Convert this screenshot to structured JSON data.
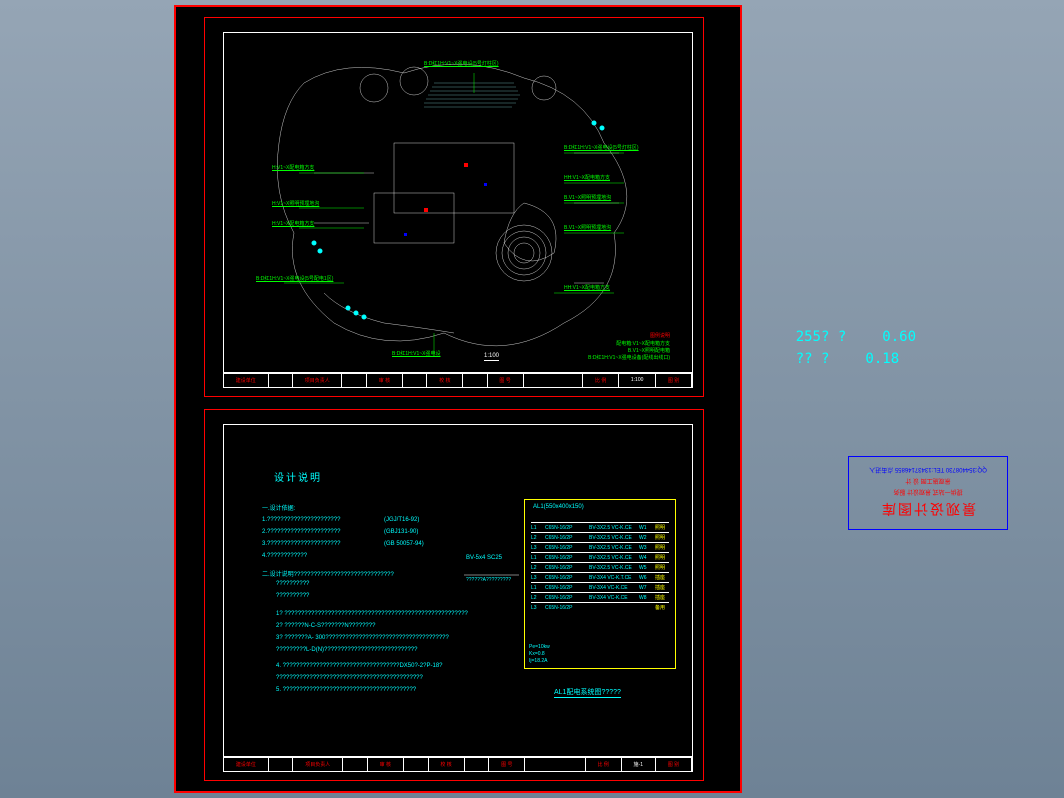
{
  "readout": {
    "r1k": "255?  ?",
    "r1v": "0.60",
    "r2k": "??  ?",
    "r2v": "0.18"
  },
  "stamp": {
    "main": "景观设计图库",
    "l1": "提供一站式 景观设计 服务",
    "l2": "景观施工图 设 计",
    "num": "QQ:354408730  TEL:13437146855  点击进入"
  },
  "plan": {
    "scale": "1:100",
    "legend_title": "图例说明",
    "legend1": "配电箱:V1~X配电箱方支",
    "legend2": "B.V1~X照明配电箱",
    "legend3": "B:D红1H:V1~X强电设备(配线出线口)",
    "labels": {
      "a": "B:D红1H:V1~X强电设(5号灯柱区)",
      "b": "H:V1~X配电箱方支",
      "c": "H:V1~X照明预埋地沟",
      "d": "B:D红1H:V1~X强电设(5号灯柱区)",
      "e": "HH:V1~X配电箱方支",
      "f": "B.V1~X照明预埋地沟",
      "g": "B:D红1H:V1~X强电设(5号配电1区)",
      "h": "H:V1~X配电箱方支",
      "i": "B:D红1H:V1~X强电设",
      "j": "B.V1~X照明预埋地沟"
    }
  },
  "notes": {
    "title": "设计说明",
    "h1": "一.设计依据:",
    "n1": "1.??????????????????????",
    "n1b": "(JGJ/T16-92)",
    "n2": "2.??????????????????????",
    "n2b": "(GBJ131-90)",
    "n3": "3.??????????????????????",
    "n3b": "(GB 50057-94)",
    "n4": "4.????????????",
    "h2": "二.设计说明??????????????????????????????",
    "n5": "??????????",
    "n6": "??????????",
    "n7": "1? ???????????????????????????????????????????????????????",
    "n8": "2? ??????N-C-S???????N????????",
    "n9": "3? ???????A- 300?????????????????????????????????????",
    "n10": "    ?????????L-D(N)????????????????????????????",
    "n11": "4.  ???????????????????????????????????DX50?-2?P-18?",
    "n12": "     ????????????????????????????????????????????",
    "n13": "5.  ????????????????????????????????????????",
    "cable": "BV-5x4  SC25",
    "cable2": "??????A?????????",
    "box_title": "AL1(550x400x150)",
    "panel_title": "AL1配电系统图?????",
    "rows": [
      {
        "l": "L1",
        "m": "C65N-16/2P",
        "r": "BV-3X2.5 VC-K.CE",
        "n": "W1",
        "e": "照明"
      },
      {
        "l": "L2",
        "m": "C65N-16/2P",
        "r": "BV-3X2.5 VC-K.CE",
        "n": "W2",
        "e": "照明"
      },
      {
        "l": "L3",
        "m": "C65N-16/2P",
        "r": "BV-3X2.5 VC-K.CE",
        "n": "W3",
        "e": "照明"
      },
      {
        "l": "L1",
        "m": "C65N-16/2P",
        "r": "BV-3X2.5 VC-K.CE",
        "n": "W4",
        "e": "照明"
      },
      {
        "l": "L2",
        "m": "C65N-16/2P",
        "r": "BV-3X2.5 VC-K.CE",
        "n": "W5",
        "e": "照明"
      },
      {
        "l": "L3",
        "m": "C65N-16/2P",
        "r": "BV-3X4 VC-K.T.CE",
        "n": "W6",
        "e": "插座"
      },
      {
        "l": "L1",
        "m": "C65N-16/2P",
        "r": "BV-3X4 VC-K.CE",
        "n": "W7",
        "e": "插座"
      },
      {
        "l": "L2",
        "m": "C65N-16/2P",
        "r": "BV-3X4 VC-K.CE",
        "n": "W8",
        "e": "插座"
      },
      {
        "l": "L3",
        "m": "C65N-16/2P",
        "r": "",
        "n": "",
        "e": "备用"
      }
    ],
    "box_side1": "Pe=10kw",
    "box_side2": "Kx=0.8",
    "box_side3": "Ij=18.2A"
  },
  "tb": {
    "c1": "建设单位",
    "c2": "",
    "c3": "项目负责人",
    "c4": "",
    "c5": "审 核",
    "c6": "",
    "c7": "校 核",
    "c8": "",
    "c9": "图 号",
    "c10": "",
    "c11": "比 例",
    "c12": "1:100",
    "c13": "图 别",
    "d1": "设计人",
    "d2": "",
    "d3": "专业负责人",
    "d4": "",
    "d5": "审 定",
    "d6": "",
    "d7": "会 签",
    "d8": "",
    "d9": "日 期",
    "d10": "",
    "d11": "张 号",
    "d12": "施-1"
  }
}
